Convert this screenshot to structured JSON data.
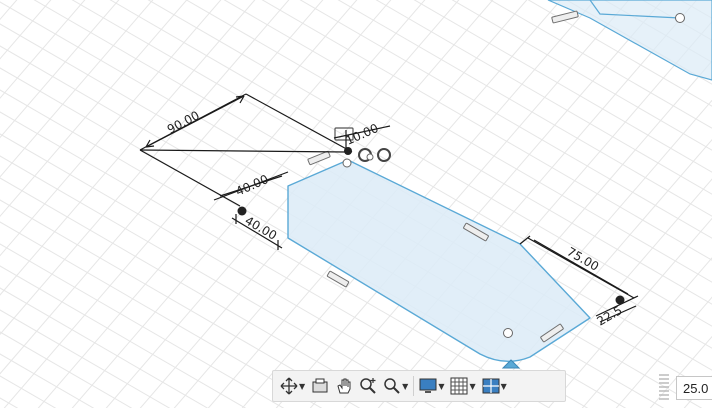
{
  "dimensions": {
    "top_length": "90.00",
    "top_width": "10.00",
    "chamfer_left": "40.00",
    "left_height": "40.00",
    "right_length": "75.00",
    "right_small": "22.5"
  },
  "navigation_toolbar": {
    "items": [
      {
        "name": "orbit",
        "icon": "orbit-icon",
        "dropdown": true
      },
      {
        "name": "look-at",
        "icon": "look-at-icon",
        "dropdown": false
      },
      {
        "name": "pan",
        "icon": "pan-hand-icon",
        "dropdown": false
      },
      {
        "name": "zoom",
        "icon": "zoom-icon",
        "dropdown": false
      },
      {
        "name": "fit",
        "icon": "zoom-window-icon",
        "dropdown": true
      },
      {
        "name": "display-settings",
        "icon": "monitor-icon",
        "dropdown": true
      },
      {
        "name": "grid-and-snaps",
        "icon": "grid-icon",
        "dropdown": true
      },
      {
        "name": "viewports",
        "icon": "viewports-icon",
        "dropdown": true
      }
    ]
  },
  "zoom_field": {
    "value": "25.0"
  },
  "colors": {
    "sketch_line": "#5aa9d6",
    "profile_fill": "#dcebf7",
    "grid_line": "#e6e6e6",
    "dimension_line": "#1a1a1a",
    "toolbar_bg": "#f3f3f3"
  }
}
